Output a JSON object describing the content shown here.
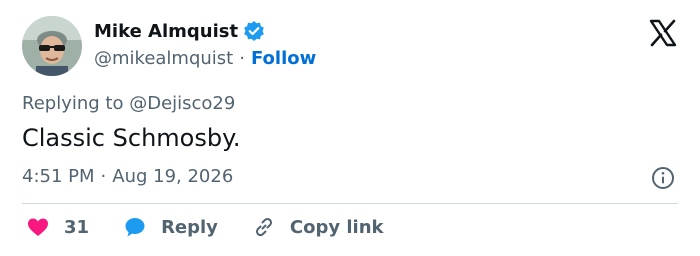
{
  "author": {
    "name": "Mike Almquist",
    "handle": "@mikealmquist",
    "separator": "·",
    "follow_label": "Follow"
  },
  "tweet": {
    "replying_prefix": "Replying to ",
    "replying_to": "@Dejisco29",
    "text": "Classic Schmosby.",
    "time": "4:51 PM",
    "meta_separator": "·",
    "date": "Aug 19, 2026"
  },
  "actions": {
    "like_count": "31",
    "reply_label": "Reply",
    "copy_link_label": "Copy link"
  },
  "colors": {
    "accent": "#1d9bf0",
    "follow": "#006fd6",
    "like": "#f91880",
    "secondary_text": "#536471"
  },
  "icons": [
    "verified-badge-icon",
    "x-logo-icon",
    "info-icon",
    "heart-icon",
    "reply-bubble-icon",
    "link-icon"
  ]
}
